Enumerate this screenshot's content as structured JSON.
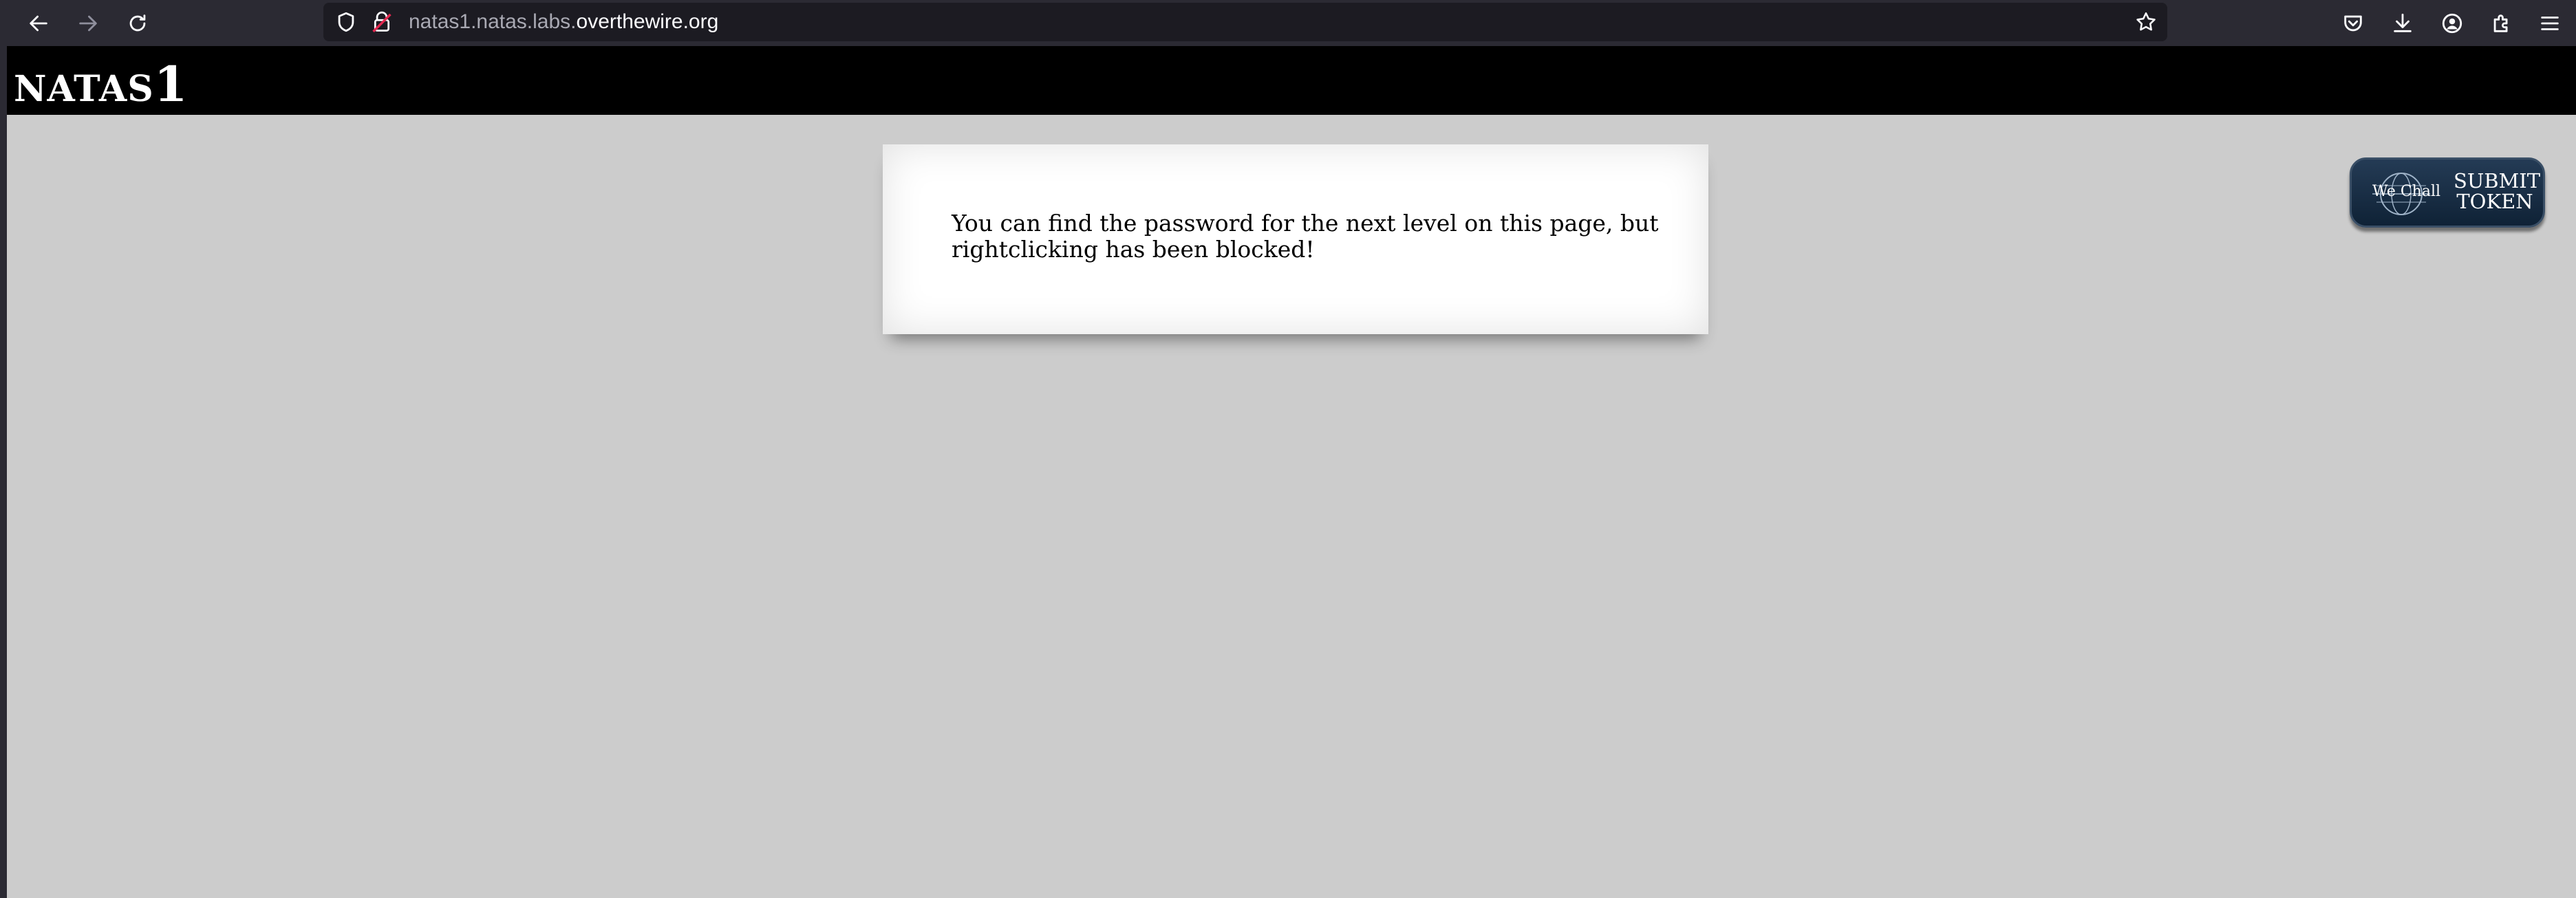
{
  "browser": {
    "url_prefix": "natas1.natas.labs.",
    "url_domain": "overthewire.org",
    "icons": [
      "back-icon",
      "forward-icon",
      "reload-icon",
      "shield-icon",
      "lock-icon",
      "star-icon",
      "pocket-icon",
      "download-icon",
      "account-icon",
      "extensions-icon",
      "menu-icon"
    ]
  },
  "page": {
    "logo_text": "NATAS",
    "logo_level": "1",
    "message": "You can find the password for the next level on this page, but rightclicking has been blocked!"
  },
  "wechall": {
    "brand": "We Chall",
    "submit_line1": "SUBMIT",
    "submit_line2": "TOKEN"
  },
  "colors": {
    "page_bg": "#cccccc",
    "header_bg": "#000000",
    "toolbar_bg": "#2b2a33",
    "urlbar_bg": "#1c1b22"
  }
}
